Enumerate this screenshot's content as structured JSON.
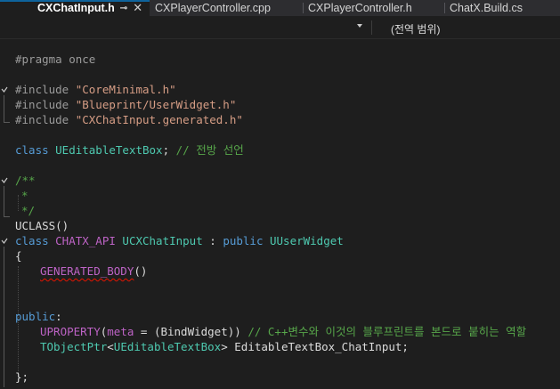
{
  "tabs": [
    {
      "label": "CXChatInput.h",
      "active": true,
      "pin_icon": "pin-icon",
      "close_icon": "close-icon"
    },
    {
      "label": "CXPlayerController.cpp",
      "active": false
    },
    {
      "label": "CXPlayerController.h",
      "active": false
    },
    {
      "label": "ChatX.Build.cs",
      "active": false
    }
  ],
  "navbar": {
    "dropdown_icon": "chevron-down-icon",
    "scope_label": "(전역 범위)"
  },
  "colors": {
    "keyword": "#569cd6",
    "comment": "#57a64a",
    "string": "#d69d85",
    "preprocessor": "#9b9b9b",
    "type": "#4ec9b0",
    "macro": "#bd63c5",
    "error_squiggle": "#e51400",
    "active_tab_accent": "#0e639c"
  },
  "code": {
    "l1": {
      "pp": "#pragma once"
    },
    "l2": {
      "pp": "#include ",
      "str": "\"CoreMinimal.h\""
    },
    "l3": {
      "pp": "#include ",
      "str": "\"Blueprint/UserWidget.h\""
    },
    "l4": {
      "pp": "#include ",
      "str": "\"CXChatInput.generated.h\""
    },
    "l5": {
      "kw": "class ",
      "type": "UEditableTextBox",
      "p": "; ",
      "cmt": "// 전방 선언"
    },
    "l6": {
      "cmt": "/**"
    },
    "l7": {
      "cmt": "*"
    },
    "l8": {
      "cmt": "*/"
    },
    "l9": {
      "p": "UCLASS()"
    },
    "l10": {
      "kw1": "class ",
      "macro": "CHATX_API ",
      "type1": "UCXChatInput",
      "p": " : ",
      "kw2": "public ",
      "type2": "UUserWidget"
    },
    "l11": {
      "p": "{"
    },
    "l12": {
      "squig": "GENERATED_BODY",
      "p": "()"
    },
    "l13": {
      "kw": "public",
      "p": ":"
    },
    "l14": {
      "macro": "UPROPERTY",
      "p1": "(",
      "macro2": "meta",
      "p2": " = (BindWidget)) ",
      "cmt": "// C++변수와 이것의 블루프린트를 본드로 붙히는 역할"
    },
    "l15": {
      "type1": "TObjectPtr",
      "p1": "<",
      "type2": "UEditableTextBox",
      "p2": "> EditableTextBox_ChatInput;"
    },
    "l16": {
      "p": "};"
    }
  }
}
